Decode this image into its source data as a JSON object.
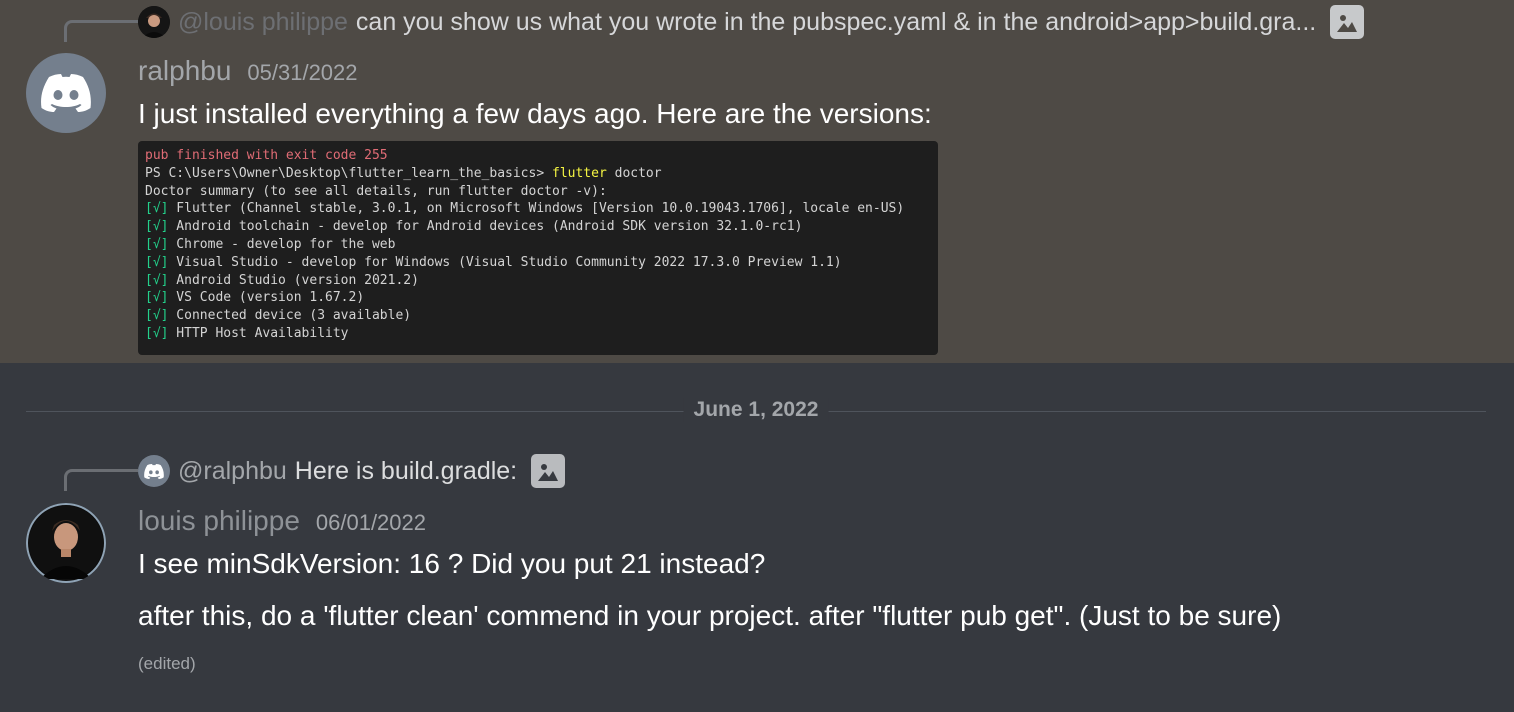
{
  "message1": {
    "reply": {
      "mention": "@louis philippe",
      "text": "can you show us what you wrote in the pubspec.yaml & in the android>app>build.gra..."
    },
    "author": "ralphbu",
    "timestamp": "05/31/2022",
    "text": "I just installed everything a few days ago.  Here are the versions:",
    "terminal": {
      "error_line": "pub finished with exit code 255",
      "prompt": "PS C:\\Users\\Owner\\Desktop\\flutter_learn_the_basics> ",
      "command": "flutter",
      "command_arg": " doctor",
      "summary": "Doctor summary (to see all details, run flutter doctor -v):",
      "checks": [
        {
          "mark": "[√]",
          "text": " Flutter (Channel stable, 3.0.1, on Microsoft Windows [Version 10.0.19043.1706], locale en-US)"
        },
        {
          "mark": "[√]",
          "text": " Android toolchain - develop for Android devices (Android SDK version 32.1.0-rc1)"
        },
        {
          "mark": "[√]",
          "text": " Chrome - develop for the web"
        },
        {
          "mark": "[√]",
          "text": " Visual Studio - develop for Windows (Visual Studio Community 2022 17.3.0 Preview 1.1)"
        },
        {
          "mark": "[√]",
          "text": " Android Studio (version 2021.2)"
        },
        {
          "mark": "[√]",
          "text": " VS Code (version 1.67.2)"
        },
        {
          "mark": "[√]",
          "text": " Connected device (3 available)"
        },
        {
          "mark": "[√]",
          "text": " HTTP Host Availability"
        }
      ]
    }
  },
  "date_divider": "June 1, 2022",
  "message2": {
    "reply": {
      "mention": "@ralphbu",
      "text": "Here is build.gradle:"
    },
    "author": "louis philippe",
    "timestamp": "06/01/2022",
    "lines": [
      "I see minSdkVersion: 16 ? Did you put 21 instead?",
      "after this, do a 'flutter clean' commend in your project. after \"flutter pub get\". (Just to be sure)"
    ],
    "edited": "(edited)"
  },
  "colors": {
    "highlight_bg": "#4e4a45",
    "chat_bg": "#36393f",
    "discord_blurple": "#5865f2",
    "discord_grey": "#747f8d",
    "terminal_bg": "#1e1e1e"
  },
  "icons": [
    "discord-logo-icon",
    "image-attachment-icon",
    "person-avatar-icon"
  ]
}
